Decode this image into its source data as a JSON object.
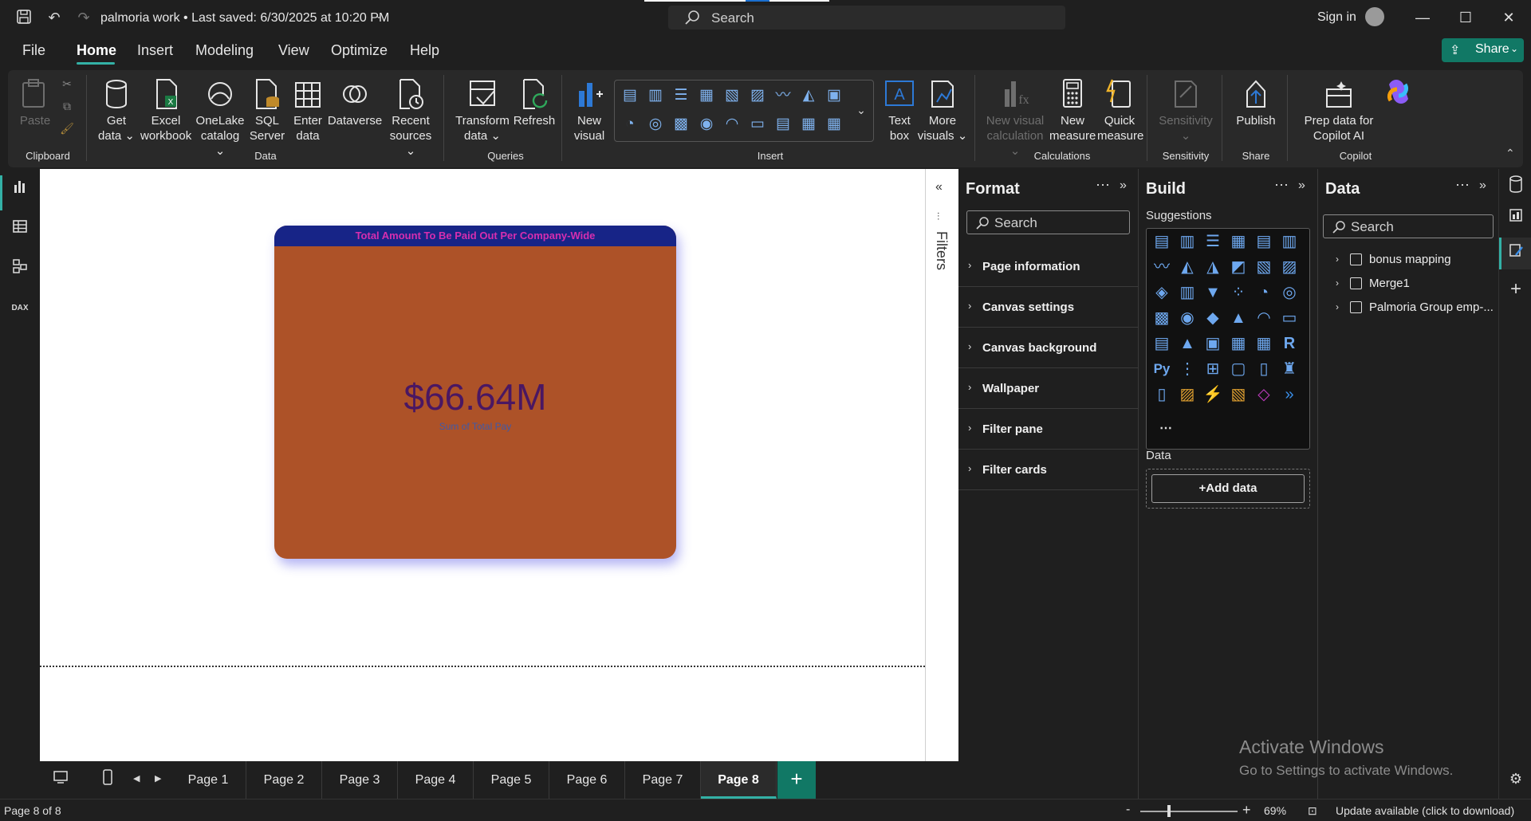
{
  "titlebar": {
    "file_title": "palmoria work",
    "saved_status": "Last saved: 6/30/2025 at 10:20 PM",
    "search_placeholder": "Search",
    "sign_in": "Sign in"
  },
  "menu": {
    "file": "File",
    "home": "Home",
    "insert": "Insert",
    "modeling": "Modeling",
    "view": "View",
    "optimize": "Optimize",
    "help": "Help",
    "share": "Share"
  },
  "ribbon": {
    "clipboard": {
      "paste": "Paste",
      "group": "Clipboard"
    },
    "data": {
      "get_data": "Get data",
      "excel": "Excel workbook",
      "onelake": "OneLake catalog",
      "sql": "SQL Server",
      "enter": "Enter data",
      "dataverse": "Dataverse",
      "recent": "Recent sources",
      "group": "Data"
    },
    "queries": {
      "transform": "Transform data",
      "refresh": "Refresh",
      "group": "Queries"
    },
    "insert": {
      "new_visual": "New visual",
      "text_box": "Text box",
      "more_visuals": "More visuals",
      "group": "Insert"
    },
    "calculations": {
      "new_visual_calc": "New visual calculation",
      "new_measure": "New measure",
      "quick_measure": "Quick measure",
      "group": "Calculations"
    },
    "sensitivity": {
      "label": "Sensitivity",
      "group": "Sensitivity"
    },
    "share": {
      "publish": "Publish",
      "group": "Share"
    },
    "copilot": {
      "prep": "Prep data for Copilot AI",
      "group": "Copilot"
    }
  },
  "card": {
    "title": "Total Amount To Be Paid Out Per Company-Wide",
    "value": "$66.64M",
    "subtitle": "Sum of Total Pay",
    "colors": {
      "header": "#172487",
      "title": "#d62eaf",
      "body": "#ad5228",
      "value": "#4a1762"
    }
  },
  "filters": {
    "label": "Filters"
  },
  "tabs": [
    "Page 1",
    "Page 2",
    "Page 3",
    "Page 4",
    "Page 5",
    "Page 6",
    "Page 7",
    "Page 8"
  ],
  "active_tab": "Page 8",
  "status": {
    "page_indicator": "Page 8 of 8",
    "zoom_level": "69%",
    "update": "Update available (click to download)"
  },
  "format_pane": {
    "title": "Format",
    "search_placeholder": "Search",
    "sections": [
      "Page information",
      "Canvas settings",
      "Canvas background",
      "Wallpaper",
      "Filter pane",
      "Filter cards"
    ]
  },
  "build_pane": {
    "title": "Build",
    "suggestions_label": "Suggestions",
    "data_label": "Data",
    "add_data": "+Add data",
    "python_label": "Py",
    "r_label": "R"
  },
  "data_pane": {
    "title": "Data",
    "search_placeholder": "Search",
    "tables": [
      "bonus mapping",
      "Merge1",
      "Palmoria Group emp-..."
    ]
  },
  "watermark": {
    "line1": "Activate Windows",
    "line2": "Go to Settings to activate Windows."
  }
}
